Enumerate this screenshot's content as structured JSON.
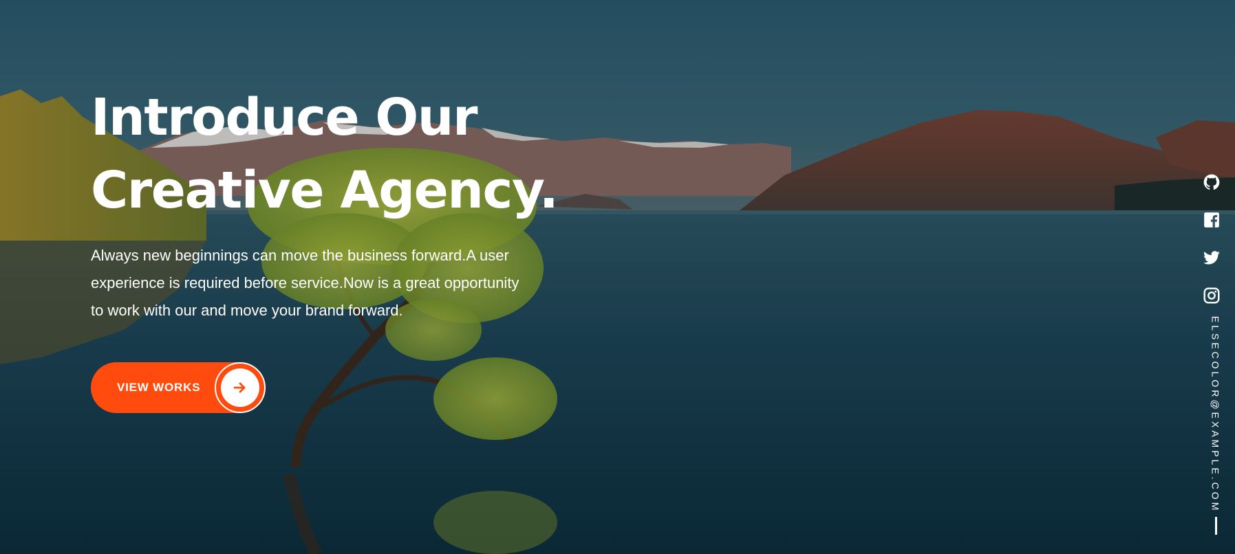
{
  "hero": {
    "title_line1": "Introduce Our",
    "title_line2": "Creative Agency.",
    "description": "Always new beginnings can move the business forward.A user experience is required before service.Now is a great opportunity to work with our and move your brand forward.",
    "cta_label": "VIEW WORKS",
    "cta_icon": "arrow-right-icon",
    "accent_color": "#ff4b0d",
    "background_image": "lake-mountains-tree-photo"
  },
  "social": {
    "icons": [
      "github-icon",
      "facebook-icon",
      "twitter-icon",
      "instagram-icon"
    ],
    "email": "ELSECOLOR@EXAMPLE.COM"
  }
}
